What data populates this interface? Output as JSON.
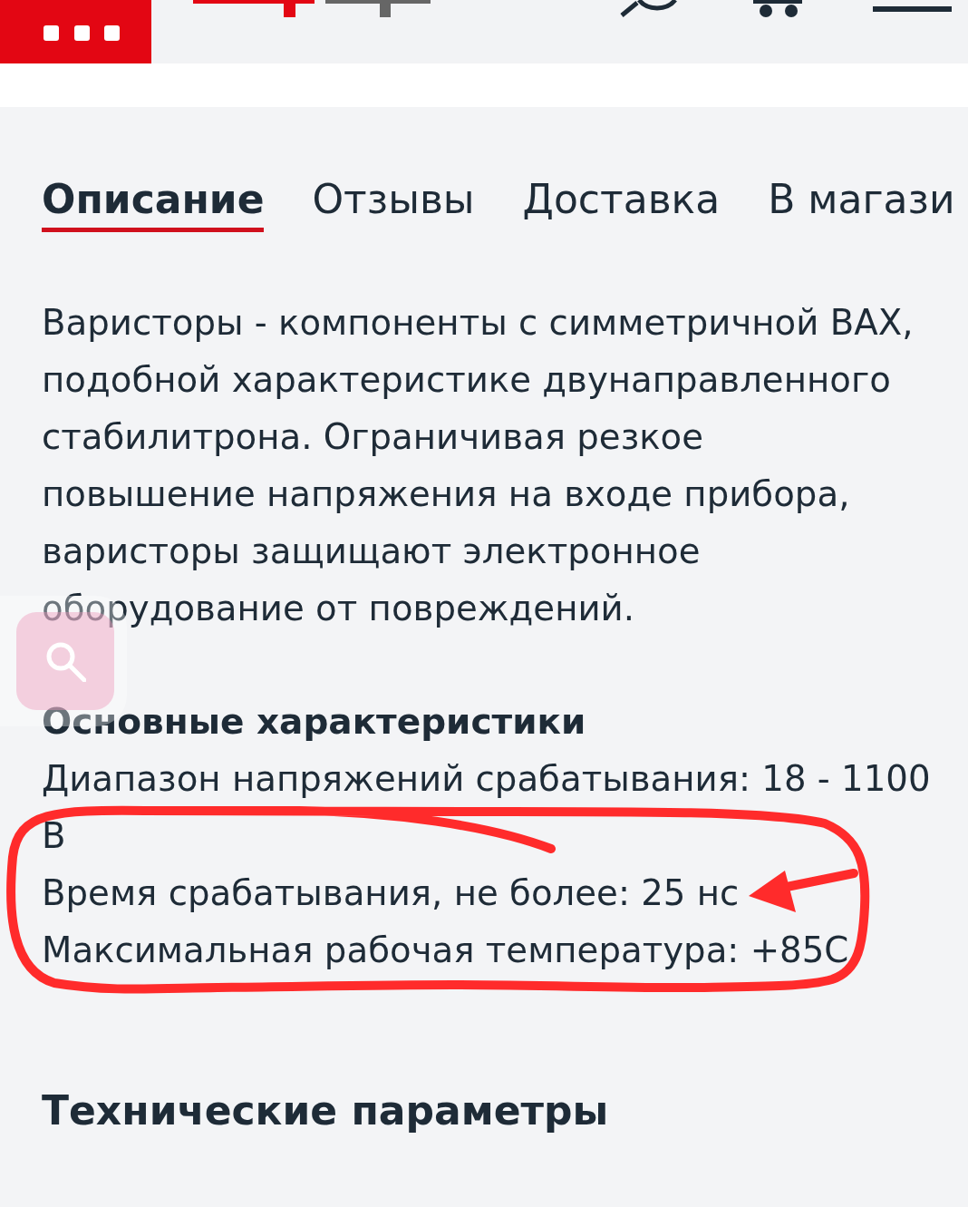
{
  "tabs": [
    {
      "label": "Описание",
      "selected": true
    },
    {
      "label": "Отзывы",
      "selected": false
    },
    {
      "label": "Доставка",
      "selected": false
    },
    {
      "label": "В магази",
      "selected": false
    }
  ],
  "description": "Варисторы - компоненты с симметричной ВАХ, подобной характеристике двунаправленного стабилитрона. Ограничивая резкое повышение напряжения на входе прибора, варисторы защищают электронное оборудование от повреждений.",
  "main_specs": {
    "heading": "Основные характеристики",
    "lines": [
      "Диапазон напряжений срабатывания: 18 - 1100 В",
      "Время срабатывания, не более: 25 нс",
      "Максимальная рабочая температура: +85С"
    ]
  },
  "technical_params": {
    "heading": "Технические параметры"
  }
}
